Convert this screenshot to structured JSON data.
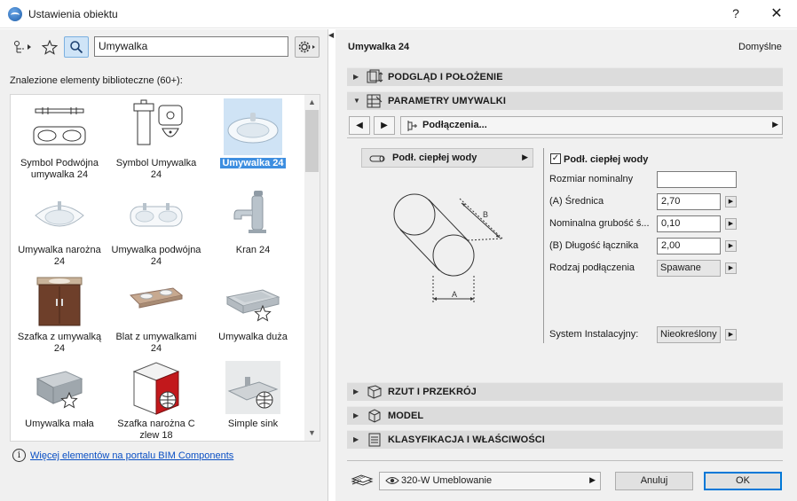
{
  "window": {
    "title": "Ustawienia obiektu",
    "help": "?",
    "close": "✕"
  },
  "left": {
    "search_value": "Umywalka",
    "found_label": "Znalezione elementy biblioteczne (60+):",
    "items": [
      {
        "label": "Symbol Podwójna umywalka 24",
        "icon": "double-sink-symbol"
      },
      {
        "label": "Symbol Umywalka 24",
        "icon": "sink-symbol"
      },
      {
        "label": "Umywalka 24",
        "icon": "washbasin",
        "selected": true
      },
      {
        "label": "Umywalka narożna 24",
        "icon": "corner-sink"
      },
      {
        "label": "Umywalka podwójna 24",
        "icon": "double-sink"
      },
      {
        "label": "Kran 24",
        "icon": "faucet"
      },
      {
        "label": "Szafka z umywalką 24",
        "icon": "sink-cabinet"
      },
      {
        "label": "Blat z umywalkami 24",
        "icon": "countertop-sinks"
      },
      {
        "label": "Umywalka duża",
        "icon": "large-sink"
      },
      {
        "label": "Umywalka mała",
        "icon": "small-sink"
      },
      {
        "label": "Szafka narożna C zlew 18",
        "icon": "corner-cabinet-sink"
      },
      {
        "label": "Simple sink",
        "icon": "simple-sink"
      }
    ],
    "portal_link": "Więcej elementów na portalu BIM Components"
  },
  "right": {
    "object_name": "Umywalka 24",
    "default_label": "Domyślne",
    "sections": {
      "preview": "PODGLĄD I POŁOŻENIE",
      "params": "PARAMETRY UMYWALKI",
      "plan": "RZUT I PRZEKRÓJ",
      "model": "MODEL",
      "classification": "KLASYFIKACJA I WŁAŚCIWOŚCI"
    },
    "page_select": "Podłączenia...",
    "connection_dropdown": "Podł. ciepłej wody",
    "diagram": {
      "label_a": "A",
      "label_b": "B"
    },
    "props": {
      "check_label": "Podł. ciepłej wody",
      "nominal_size_label": "Rozmiar nominalny",
      "nominal_size_value": "",
      "diameter_label": "(A) Średnica",
      "diameter_value": "2,70",
      "wall_label": "Nominalna grubość ś...",
      "wall_value": "0,10",
      "length_label": "(B) Długość łącznika",
      "length_value": "2,00",
      "conn_type_label": "Rodzaj podłączenia",
      "conn_type_value": "Spawane",
      "system_label": "System Instalacyjny:",
      "system_value": "Nieokreślony"
    },
    "layer_value": "320-W Umeblowanie",
    "cancel_label": "Anuluj",
    "ok_label": "OK"
  }
}
